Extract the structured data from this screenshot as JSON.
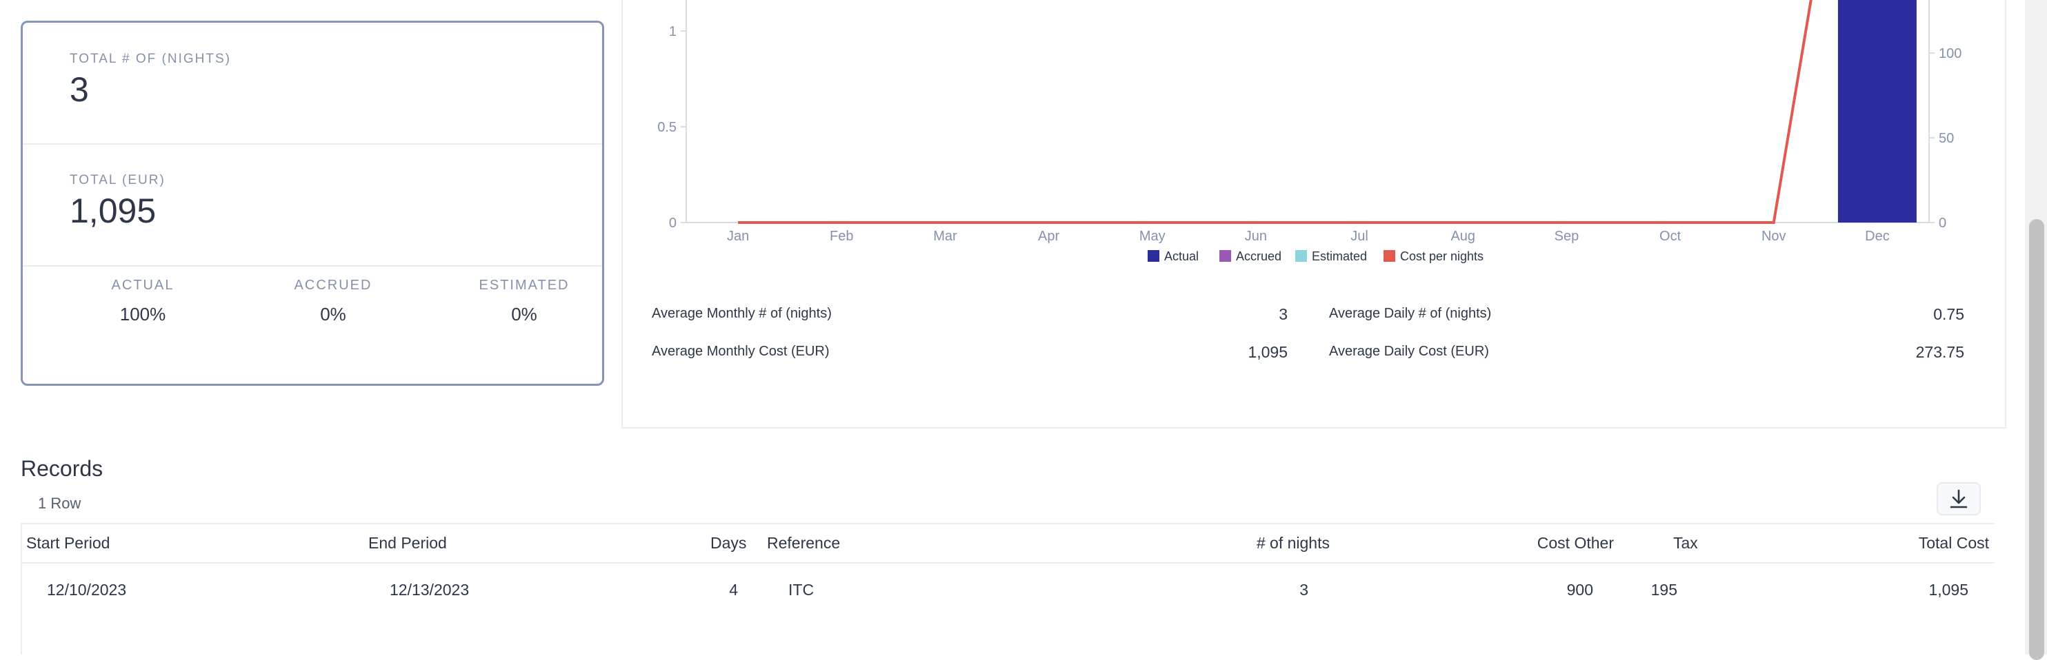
{
  "summary": {
    "nights_label": "TOTAL # OF (NIGHTS)",
    "nights_value": "3",
    "total_label": "TOTAL (EUR)",
    "total_value": "1,095",
    "actual_label": "ACTUAL",
    "actual_value": "100%",
    "accrued_label": "ACCRUED",
    "accrued_value": "0%",
    "estimated_label": "ESTIMATED",
    "estimated_value": "0%"
  },
  "chart_data": {
    "type": "bar",
    "categories": [
      "Jan",
      "Feb",
      "Mar",
      "Apr",
      "May",
      "Jun",
      "Jul",
      "Aug",
      "Sep",
      "Oct",
      "Nov",
      "Dec"
    ],
    "y_left_ticks": [
      "0",
      "0.5",
      "1"
    ],
    "y_right_ticks": [
      "0",
      "50",
      "100"
    ],
    "series": [
      {
        "name": "Actual",
        "kind": "bar",
        "axis": "left",
        "values": [
          0,
          0,
          0,
          0,
          0,
          0,
          0,
          0,
          0,
          0,
          0,
          3
        ]
      },
      {
        "name": "Accrued",
        "kind": "bar",
        "axis": "left",
        "values": [
          0,
          0,
          0,
          0,
          0,
          0,
          0,
          0,
          0,
          0,
          0,
          0
        ]
      },
      {
        "name": "Estimated",
        "kind": "bar",
        "axis": "left",
        "values": [
          0,
          0,
          0,
          0,
          0,
          0,
          0,
          0,
          0,
          0,
          0,
          0
        ]
      },
      {
        "name": "Cost per nights",
        "kind": "line",
        "axis": "right",
        "values": [
          0,
          0,
          0,
          0,
          0,
          0,
          0,
          0,
          0,
          0,
          0,
          365
        ]
      }
    ],
    "colors": {
      "Actual": "#2b2d9e",
      "Accrued": "#9b59b6",
      "Estimated": "#8dd3dc",
      "Cost per nights": "#e05a4e"
    },
    "legend_position": "bottom"
  },
  "stats": {
    "avg_monthly_nights_label": "Average Monthly # of (nights)",
    "avg_monthly_nights_value": "3",
    "avg_monthly_cost_label": "Average Monthly Cost (EUR)",
    "avg_monthly_cost_value": "1,095",
    "avg_daily_nights_label": "Average Daily # of (nights)",
    "avg_daily_nights_value": "0.75",
    "avg_daily_cost_label": "Average Daily Cost (EUR)",
    "avg_daily_cost_value": "273.75"
  },
  "records": {
    "title": "Records",
    "count": "1 Row",
    "download_icon": "download-icon",
    "columns": [
      "Start Period",
      "End Period",
      "Days",
      "Reference",
      "# of nights",
      "Cost Other",
      "Tax",
      "Total Cost"
    ],
    "rows": [
      [
        "12/10/2023",
        "12/13/2023",
        "4",
        "ITC",
        "3",
        "900",
        "195",
        "1,095"
      ]
    ]
  }
}
